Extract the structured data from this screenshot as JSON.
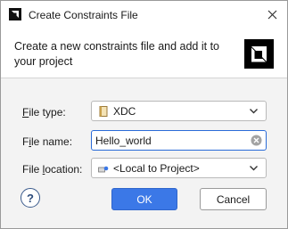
{
  "window": {
    "title": "Create Constraints File",
    "title_icon": "app-logo-icon",
    "close_icon": "close-icon"
  },
  "banner": {
    "description": "Create a new constraints file and add it to your project",
    "logo": "amd-logo"
  },
  "form": {
    "file_type": {
      "label_pre": "",
      "label_mnemonic": "F",
      "label_post": "ile type:",
      "value": "XDC",
      "icon": "file-icon"
    },
    "file_name": {
      "label_pre": "F",
      "label_mnemonic": "i",
      "label_post": "le name:",
      "value": "Hello_world",
      "clear_icon": "clear-icon"
    },
    "file_location": {
      "label_pre": "File ",
      "label_mnemonic": "l",
      "label_post": "ocation:",
      "value": "<Local to Project>",
      "icon": "project-icon"
    }
  },
  "buttons": {
    "help": "?",
    "ok": "OK",
    "cancel": "Cancel"
  },
  "colors": {
    "accent": "#3b78e7",
    "focus_border": "#2a6bd8"
  }
}
